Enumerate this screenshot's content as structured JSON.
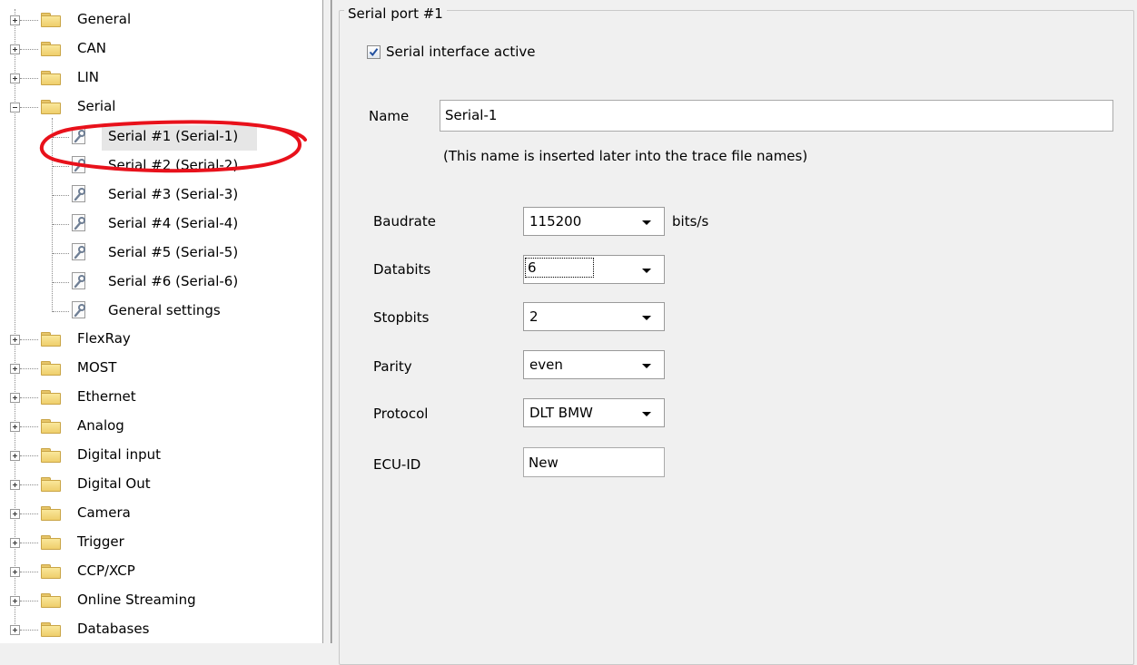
{
  "tree": {
    "items": [
      {
        "label": "General",
        "kind": "folder",
        "expanded": false
      },
      {
        "label": "CAN",
        "kind": "folder",
        "expanded": false
      },
      {
        "label": "LIN",
        "kind": "folder",
        "expanded": false
      },
      {
        "label": "Serial",
        "kind": "folder",
        "expanded": true
      },
      {
        "label": "Serial #1 (Serial-1)",
        "kind": "leaf",
        "selected": true
      },
      {
        "label": "Serial #2 (Serial-2)",
        "kind": "leaf"
      },
      {
        "label": "Serial #3 (Serial-3)",
        "kind": "leaf"
      },
      {
        "label": "Serial #4 (Serial-4)",
        "kind": "leaf"
      },
      {
        "label": "Serial #5 (Serial-5)",
        "kind": "leaf"
      },
      {
        "label": "Serial #6 (Serial-6)",
        "kind": "leaf"
      },
      {
        "label": "General settings",
        "kind": "leaf"
      },
      {
        "label": "FlexRay",
        "kind": "folder",
        "expanded": false
      },
      {
        "label": "MOST",
        "kind": "folder",
        "expanded": false
      },
      {
        "label": "Ethernet",
        "kind": "folder",
        "expanded": false
      },
      {
        "label": "Analog",
        "kind": "folder",
        "expanded": false
      },
      {
        "label": "Digital input",
        "kind": "folder",
        "expanded": false
      },
      {
        "label": "Digital Out",
        "kind": "folder",
        "expanded": false
      },
      {
        "label": "Camera",
        "kind": "folder",
        "expanded": false
      },
      {
        "label": "Trigger",
        "kind": "folder",
        "expanded": false
      },
      {
        "label": "CCP/XCP",
        "kind": "folder",
        "expanded": false
      },
      {
        "label": "Online Streaming",
        "kind": "folder",
        "expanded": false
      },
      {
        "label": "Databases",
        "kind": "folder",
        "expanded": false
      }
    ],
    "annotation_color": "#e8111b"
  },
  "serial_port": {
    "group_title": "Serial port #1",
    "active_label": "Serial interface active",
    "active_checked": true,
    "name_label": "Name",
    "name_value": "Serial-1",
    "name_hint": "(This name is inserted later into the trace file names)",
    "baudrate_label": "Baudrate",
    "baudrate_value": "115200",
    "baudrate_unit": "bits/s",
    "databits_label": "Databits",
    "databits_value": "6",
    "stopbits_label": "Stopbits",
    "stopbits_value": "2",
    "parity_label": "Parity",
    "parity_value": "even",
    "protocol_label": "Protocol",
    "protocol_value": "DLT BMW",
    "ecu_label": "ECU-ID",
    "ecu_value": "New"
  }
}
